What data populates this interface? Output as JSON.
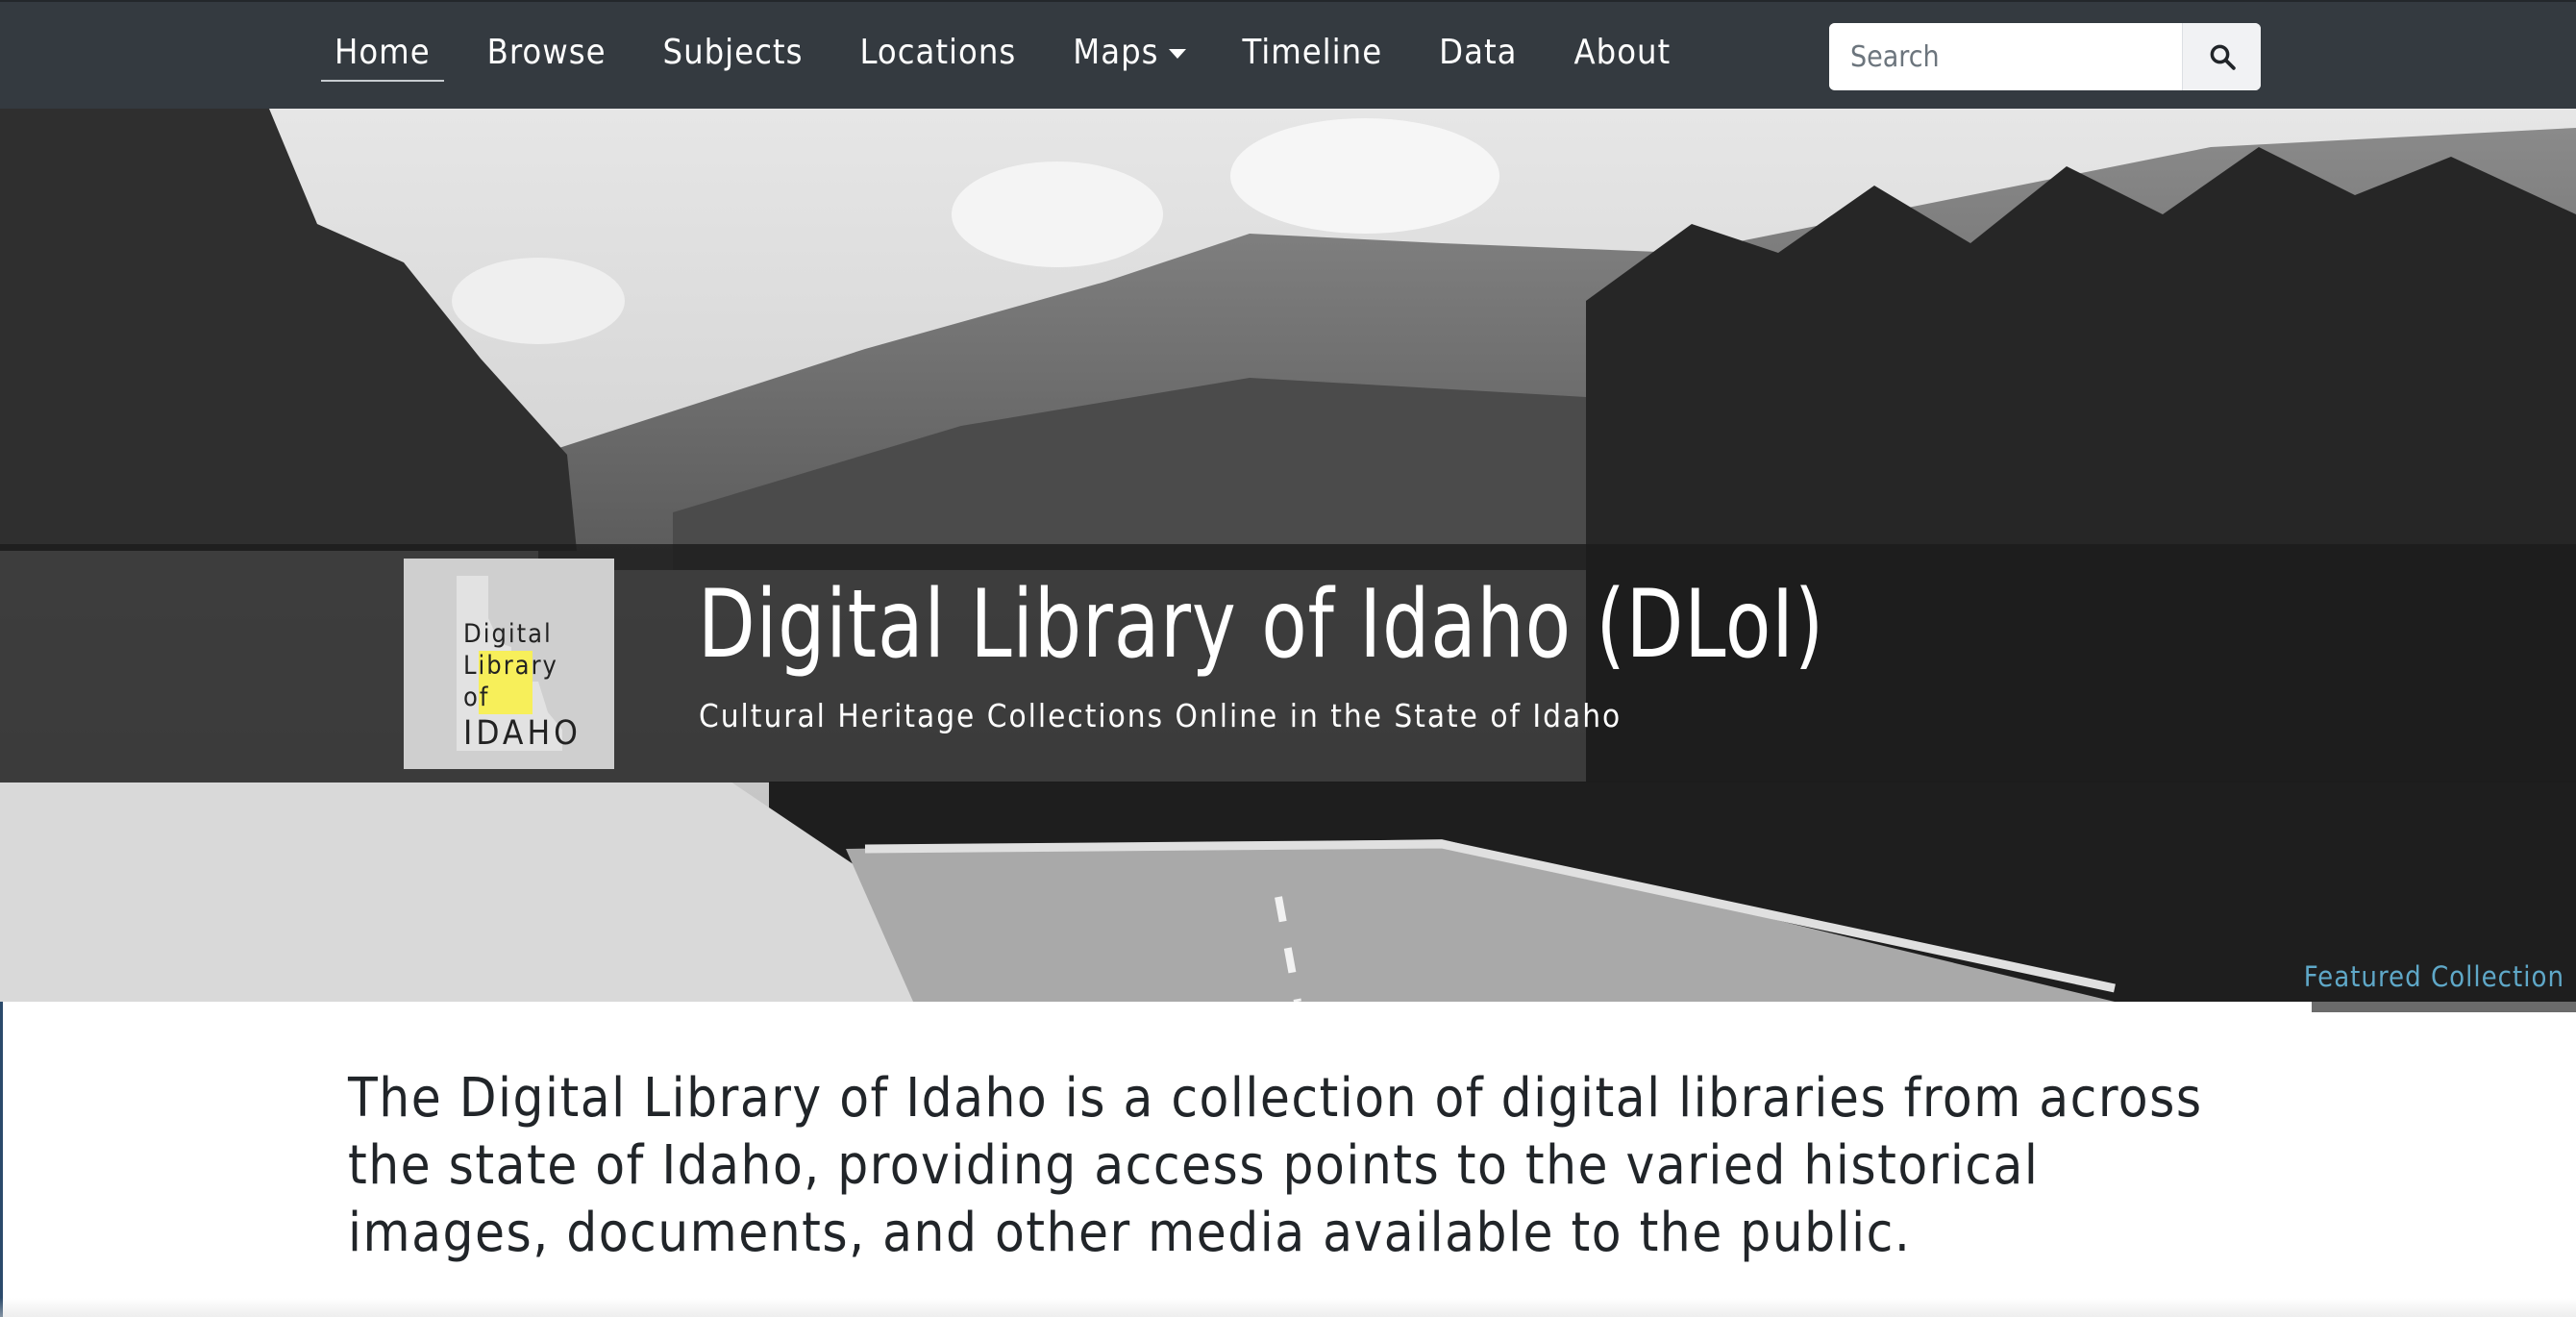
{
  "nav": {
    "items": [
      {
        "label": "Home",
        "active": true
      },
      {
        "label": "Browse"
      },
      {
        "label": "Subjects"
      },
      {
        "label": "Locations"
      },
      {
        "label": "Maps",
        "dropdown": true
      },
      {
        "label": "Timeline"
      },
      {
        "label": "Data"
      },
      {
        "label": "About"
      }
    ],
    "search": {
      "placeholder": "Search",
      "icon": "search-icon"
    }
  },
  "hero": {
    "title": "Digital Library of Idaho (DLoI)",
    "subtitle": "Cultural Heritage Collections Online in the State of Idaho",
    "logo": {
      "lines": [
        "Digital",
        "Library",
        "of"
      ],
      "state": "IDAHO",
      "highlight_color": "#f7ef5a"
    },
    "featured_link": "Featured Collection"
  },
  "intro": {
    "text": "The Digital Library of Idaho is a collection of digital libraries from across the state of Idaho, providing access points to the varied historical images, documents, and other media available to the public."
  },
  "colors": {
    "navbar": "#343a40",
    "link_accent": "#5fa8c8",
    "text": "#212529"
  }
}
